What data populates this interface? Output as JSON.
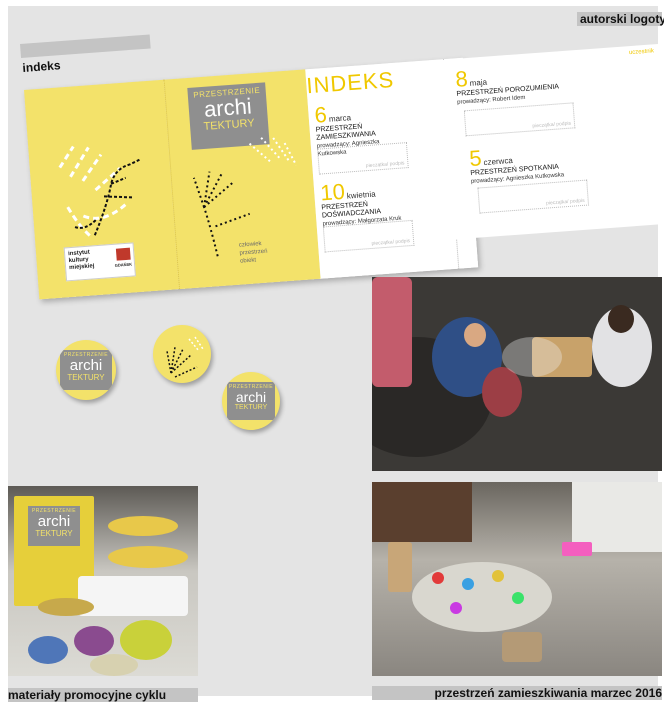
{
  "header": {
    "right_label": "autorski logotyp",
    "left_label": "indeks"
  },
  "brochure": {
    "logo": {
      "line1": "PRZESTRZENIE",
      "line2": "archi",
      "line3": "TEKTURY"
    },
    "institution": {
      "line1": "instytut",
      "line2": "kultury",
      "line3": "miejskiej",
      "partner": "GDAŃSK"
    },
    "panel2_caption": [
      "człowiek",
      "przestrzeń",
      "obiekt"
    ],
    "index_title": "INDEKS",
    "events": [
      {
        "day": "6",
        "month": "marca",
        "title": "PRZESTRZEŃ ZAMIESZKIWANIA",
        "host": "prowadzący: Agnieszka Kutkowska",
        "stamp": "pieczątka/ podpis"
      },
      {
        "day": "10",
        "month": "kwietnia",
        "title": "PRZESTRZEŃ DOŚWIADCZANIA",
        "host": "prowadzący: Małgorzata Kruk",
        "stamp": "pieczątka/ podpis"
      },
      {
        "day": "8",
        "month": "maja",
        "title": "PRZESTRZEŃ POROZUMIENIA",
        "host": "prowadzący: Robert Idem",
        "stamp": "pieczątka/ podpis"
      },
      {
        "day": "5",
        "month": "czerwca",
        "title": "PRZESTRZEŃ SPOTKANIA",
        "host": "prowadzący: Agnieszka Kutkowska",
        "stamp": "pieczątka/ podpis"
      }
    ],
    "student_label": "uczestnik"
  },
  "badges": {
    "logo": {
      "line1": "PRZESTRZENIE",
      "line2": "archi",
      "line3": "TEKTURY"
    }
  },
  "footer": {
    "left_label": "materiały promocyjne cyklu",
    "right_label": "przestrzeń zamieszkiwania marzec 2016"
  },
  "colors": {
    "yellow": "#f3e26a",
    "grey_logo": "#8f8f8f",
    "background": "#e4e4e4"
  }
}
